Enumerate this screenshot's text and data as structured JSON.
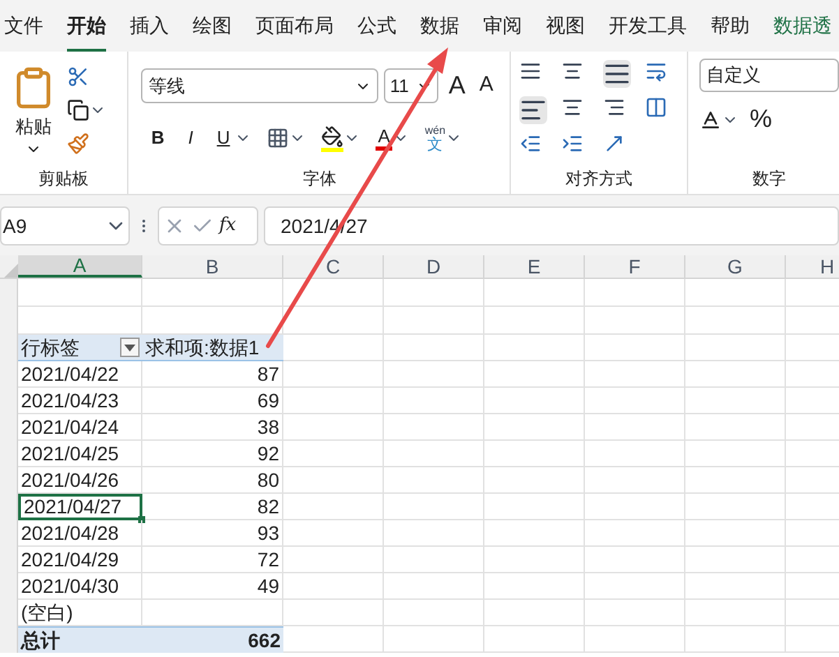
{
  "menu_tabs": [
    {
      "label": "文件",
      "selected": false,
      "contextual": false
    },
    {
      "label": "开始",
      "selected": true,
      "contextual": false
    },
    {
      "label": "插入",
      "selected": false,
      "contextual": false
    },
    {
      "label": "绘图",
      "selected": false,
      "contextual": false
    },
    {
      "label": "页面布局",
      "selected": false,
      "contextual": false
    },
    {
      "label": "公式",
      "selected": false,
      "contextual": false
    },
    {
      "label": "数据",
      "selected": false,
      "contextual": false
    },
    {
      "label": "审阅",
      "selected": false,
      "contextual": false
    },
    {
      "label": "视图",
      "selected": false,
      "contextual": false
    },
    {
      "label": "开发工具",
      "selected": false,
      "contextual": false
    },
    {
      "label": "帮助",
      "selected": false,
      "contextual": false
    },
    {
      "label": "数据透",
      "selected": false,
      "contextual": true
    }
  ],
  "ribbon": {
    "clipboard": {
      "paste_label": "粘贴",
      "group_label": "剪贴板"
    },
    "font": {
      "font_name": "等线",
      "font_size": "11",
      "grow": "A",
      "shrink": "A",
      "bold": "B",
      "italic": "I",
      "underline": "U",
      "font_color": "A",
      "phonetic_top": "wén",
      "phonetic_bottom": "文",
      "group_label": "字体"
    },
    "alignment": {
      "group_label": "对齐方式"
    },
    "number": {
      "format": "自定义",
      "percent": "%",
      "group_label": "数字"
    }
  },
  "formula_bar": {
    "name_box": "A9",
    "fx": "fx",
    "value": "2021/4/27"
  },
  "columns": [
    {
      "label": "A",
      "selected": true
    },
    {
      "label": "B",
      "selected": false
    },
    {
      "label": "C",
      "selected": false
    },
    {
      "label": "D",
      "selected": false
    },
    {
      "label": "E",
      "selected": false
    },
    {
      "label": "F",
      "selected": false
    },
    {
      "label": "G",
      "selected": false
    },
    {
      "label": "H",
      "selected": false
    }
  ],
  "pivot": {
    "header": {
      "row_label": "行标签",
      "value_label": "求和项:数据1"
    },
    "rows": [
      {
        "label": "2021/04/22",
        "value": "87",
        "selected": false
      },
      {
        "label": "2021/04/23",
        "value": "69",
        "selected": false
      },
      {
        "label": "2021/04/24",
        "value": "38",
        "selected": false
      },
      {
        "label": "2021/04/25",
        "value": "92",
        "selected": false
      },
      {
        "label": "2021/04/26",
        "value": "80",
        "selected": false
      },
      {
        "label": "2021/04/27",
        "value": "82",
        "selected": true
      },
      {
        "label": "2021/04/28",
        "value": "93",
        "selected": false
      },
      {
        "label": "2021/04/29",
        "value": "72",
        "selected": false
      },
      {
        "label": "2021/04/30",
        "value": "49",
        "selected": false
      },
      {
        "label": "(空白)",
        "value": "",
        "selected": false
      }
    ],
    "total": {
      "label": "总计",
      "value": "662"
    }
  }
}
